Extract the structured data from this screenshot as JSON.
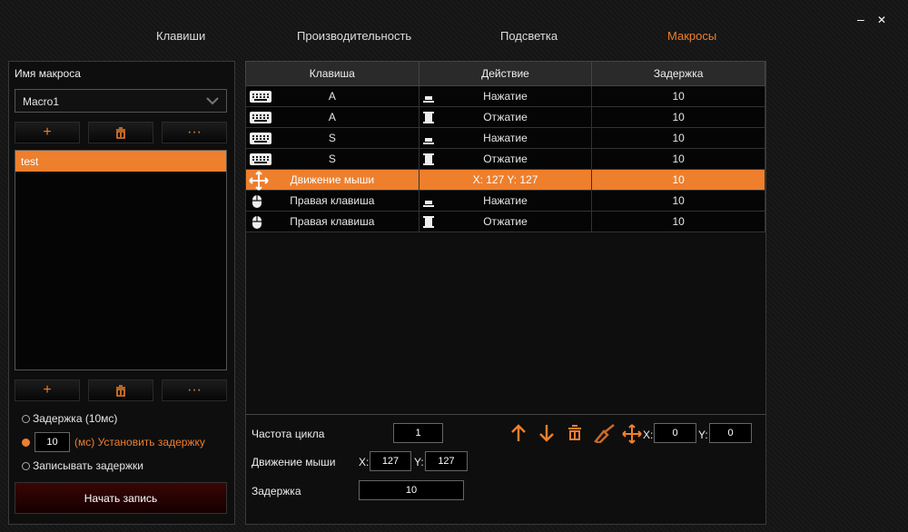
{
  "nav": {
    "tabs": [
      {
        "label": "Клавиши"
      },
      {
        "label": "Производительность"
      },
      {
        "label": "Подсветка"
      },
      {
        "label": "Макросы"
      }
    ],
    "active": "Макросы"
  },
  "window": {
    "minimize": "–",
    "close": "✕"
  },
  "left": {
    "title": "Имя макроса",
    "selected_macro": "Macro1",
    "list": [
      "test"
    ],
    "options": {
      "delay_default": "Задержка (10мс)",
      "delay_value": "10",
      "delay_set": "(мс) Установить задержку",
      "record_delays": "Записывать задержки"
    },
    "start": "Начать запись"
  },
  "table": {
    "headers": [
      "Клавиша",
      "Действие",
      "Задержка"
    ],
    "rows": [
      {
        "icon": "keyboard",
        "key": "A",
        "action": "Нажатие",
        "type": "press",
        "delay": "10"
      },
      {
        "icon": "keyboard",
        "key": "A",
        "action": "Отжатие",
        "type": "release",
        "delay": "10"
      },
      {
        "icon": "keyboard",
        "key": "S",
        "action": "Нажатие",
        "type": "press",
        "delay": "10"
      },
      {
        "icon": "keyboard",
        "key": "S",
        "action": "Отжатие",
        "type": "release",
        "delay": "10"
      },
      {
        "icon": "move",
        "key": "Движение мыши",
        "action": "X: 127 Y: 127",
        "type": "none",
        "delay": "10",
        "selected": true
      },
      {
        "icon": "mouse",
        "key": "Правая клавиша",
        "action": "Нажатие",
        "type": "press",
        "delay": "10"
      },
      {
        "icon": "mouse",
        "key": "Правая клавиша",
        "action": "Отжатие",
        "type": "release",
        "delay": "10"
      }
    ]
  },
  "bottom": {
    "cycle_label": "Частота цикла",
    "cycle": "1",
    "mouse_label": "Движение мыши",
    "x_label": "X:",
    "y_label": "Y:",
    "mx": "127",
    "my": "127",
    "delay_label": "Задержка",
    "delay": "10",
    "tx": "0",
    "ty": "0"
  },
  "colors": {
    "accent": "#ee7f2d"
  }
}
